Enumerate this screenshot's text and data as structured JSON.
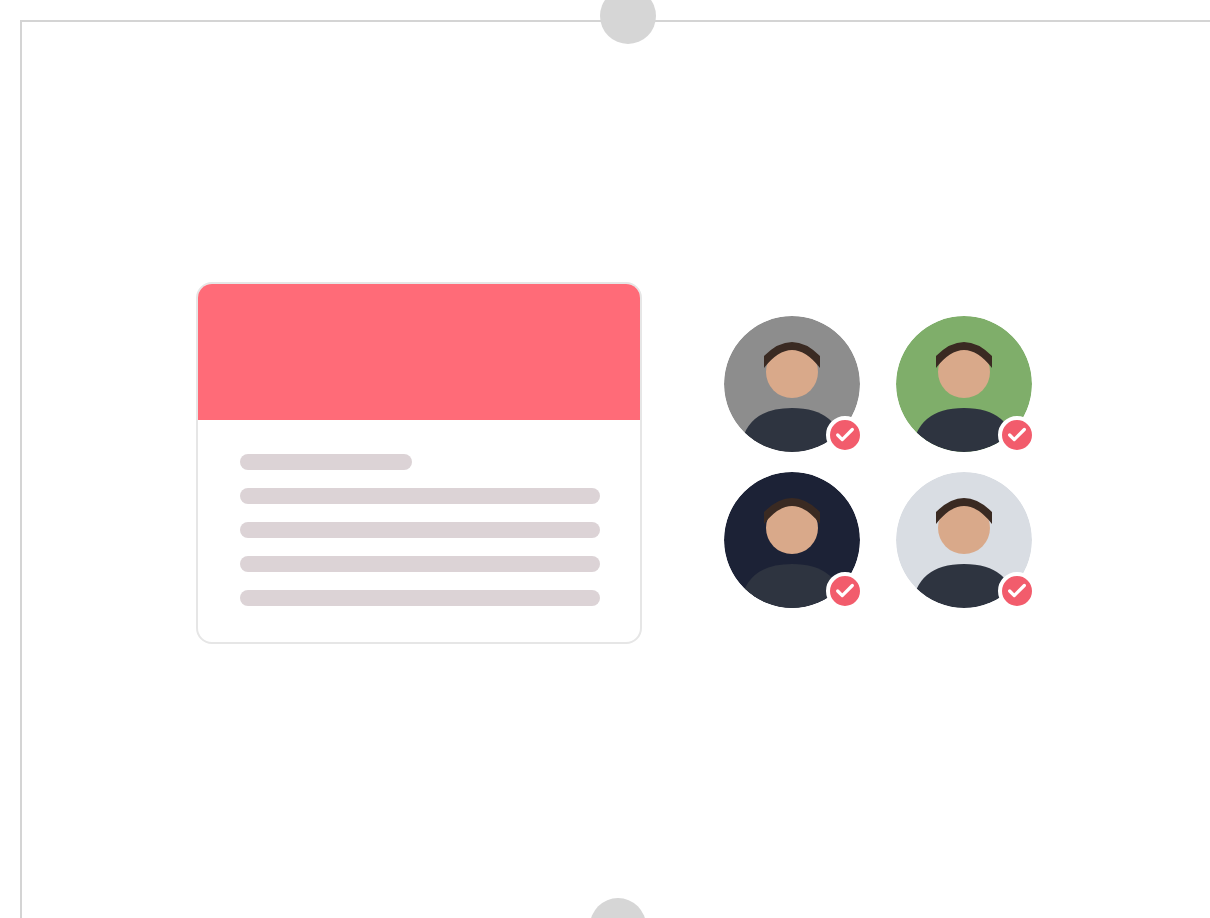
{
  "avatars": [
    {
      "checked": true,
      "color": "#8d8d8d"
    },
    {
      "checked": true,
      "color": "#7fae6a"
    },
    {
      "checked": true,
      "color": "#1c2236"
    },
    {
      "checked": true,
      "color": "#d9dde3"
    }
  ]
}
